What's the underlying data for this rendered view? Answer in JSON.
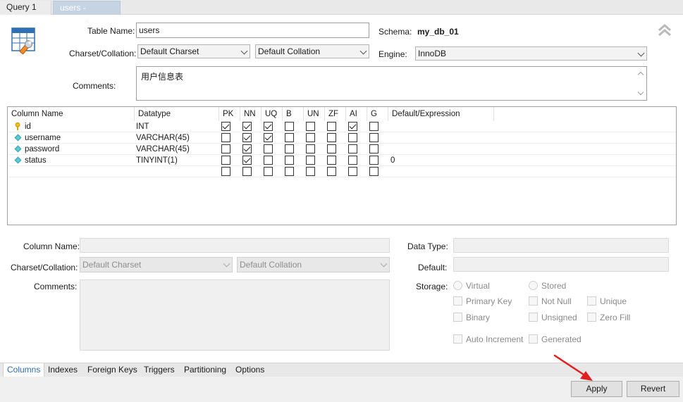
{
  "tabs": [
    {
      "label": "Query 1"
    },
    {
      "label": "users - Table"
    }
  ],
  "table": {
    "name_label": "Table Name:",
    "name_value": "users",
    "schema_label": "Schema:",
    "schema_value": "my_db_01",
    "charset_label": "Charset/Collation:",
    "charset_value": "Default Charset",
    "collation_value": "Default Collation",
    "engine_label": "Engine:",
    "engine_value": "InnoDB",
    "comments_label": "Comments:",
    "comments_value": "用户信息表"
  },
  "grid": {
    "headers": [
      "Column Name",
      "Datatype",
      "PK",
      "NN",
      "UQ",
      "B",
      "UN",
      "ZF",
      "AI",
      "G",
      "Default/Expression"
    ],
    "rows": [
      {
        "name": "id",
        "type": "INT",
        "flags": [
          true,
          true,
          true,
          false,
          false,
          false,
          true,
          false
        ],
        "default": "",
        "icon": "key-icon"
      },
      {
        "name": "username",
        "type": "VARCHAR(45)",
        "flags": [
          false,
          true,
          true,
          false,
          false,
          false,
          false,
          false
        ],
        "default": "",
        "icon": "column-diamond-icon"
      },
      {
        "name": "password",
        "type": "VARCHAR(45)",
        "flags": [
          false,
          true,
          false,
          false,
          false,
          false,
          false,
          false
        ],
        "default": "",
        "icon": "column-diamond-icon"
      },
      {
        "name": "status",
        "type": "TINYINT(1)",
        "flags": [
          false,
          true,
          false,
          false,
          false,
          false,
          false,
          false
        ],
        "default": "0",
        "icon": "column-diamond-icon"
      },
      {
        "name": "",
        "type": "",
        "flags": [
          false,
          false,
          false,
          false,
          false,
          false,
          false,
          false
        ],
        "default": "",
        "icon": ""
      }
    ]
  },
  "details": {
    "column_name_label": "Column Name:",
    "charset_label": "Charset/Collation:",
    "charset_placeholder": "Default Charset",
    "collation_placeholder": "Default Collation",
    "comments_label": "Comments:",
    "data_type_label": "Data Type:",
    "default_label": "Default:",
    "storage_label": "Storage:",
    "virtual": "Virtual",
    "stored": "Stored",
    "primary_key": "Primary Key",
    "not_null": "Not Null",
    "unique": "Unique",
    "binary": "Binary",
    "unsigned": "Unsigned",
    "zero_fill": "Zero Fill",
    "auto_increment": "Auto Increment",
    "generated": "Generated"
  },
  "bottom_tabs": [
    "Columns",
    "Indexes",
    "Foreign Keys",
    "Triggers",
    "Partitioning",
    "Options"
  ],
  "buttons": {
    "apply": "Apply",
    "revert": "Revert"
  },
  "colors": {
    "accent": "#2f6db0",
    "arrow": "#e02020",
    "tab_active": "#c6d3e3"
  }
}
